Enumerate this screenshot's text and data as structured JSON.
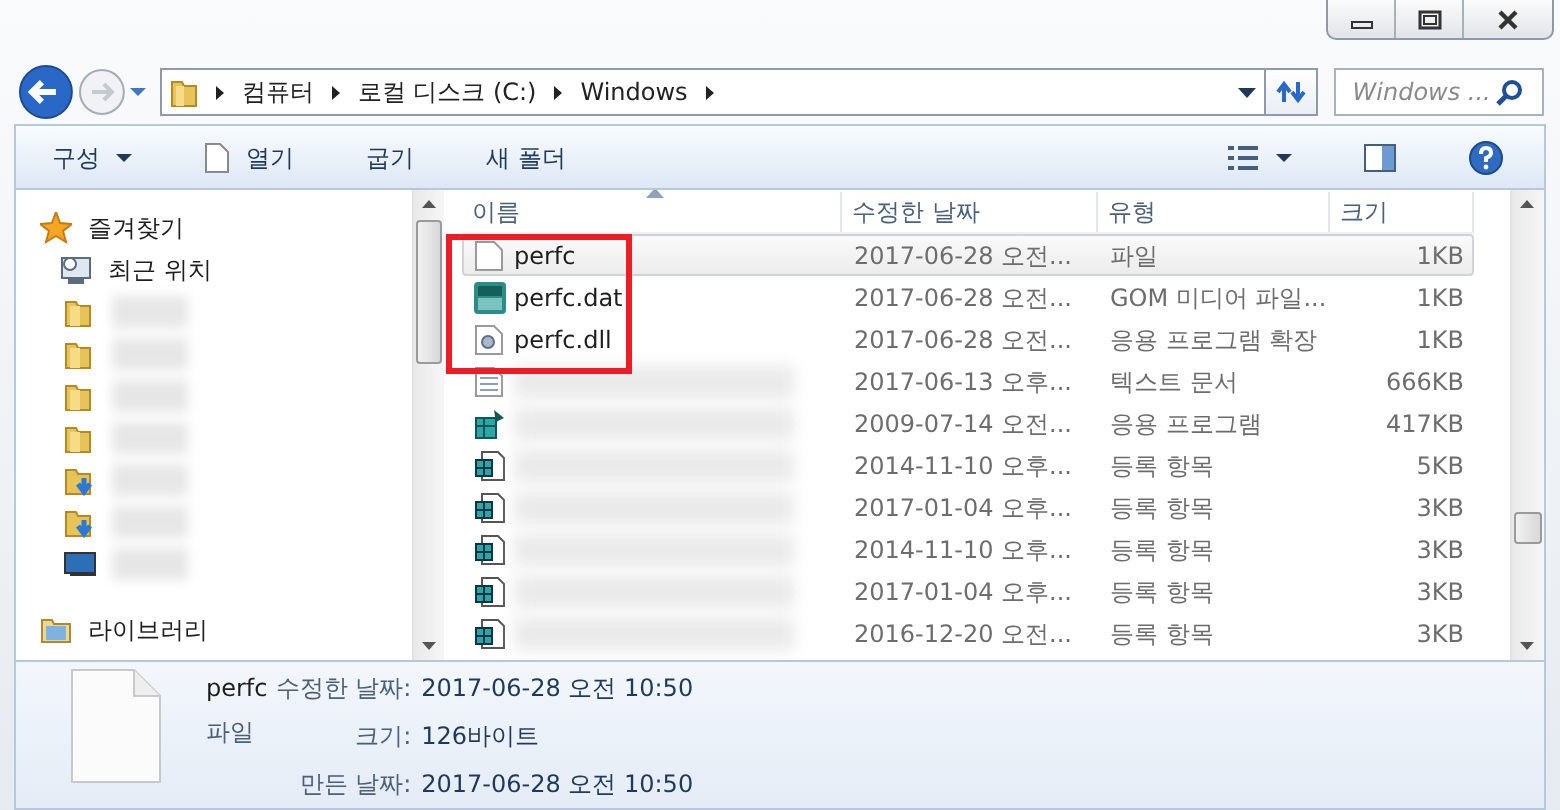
{
  "address": {
    "crumbs": [
      "컴퓨터",
      "로컬 디스크 (C:)",
      "Windows"
    ]
  },
  "search": {
    "placeholder": "Windows ..."
  },
  "toolbar": {
    "buttons": [
      {
        "label": "구성",
        "kind": "menu"
      },
      {
        "label": "열기",
        "kind": "open"
      },
      {
        "label": "굽기",
        "kind": "plain"
      },
      {
        "label": "새 폴더",
        "kind": "plain"
      }
    ]
  },
  "sidebar": {
    "items": [
      {
        "label": "즐겨찾기",
        "kind": "star"
      },
      {
        "label": "최근 위치",
        "kind": "recent"
      },
      {
        "kind": "folder"
      },
      {
        "kind": "folder"
      },
      {
        "kind": "folder"
      },
      {
        "kind": "folder"
      },
      {
        "kind": "download"
      },
      {
        "kind": "download"
      },
      {
        "kind": "desktop"
      },
      {
        "label": "라이브러리",
        "kind": "library"
      }
    ]
  },
  "table": {
    "columns": [
      "이름",
      "수정한 날짜",
      "유형",
      "크기"
    ],
    "rows": [
      {
        "name": "perfc",
        "date": "2017-06-28 오전...",
        "type": "파일",
        "size": "1KB",
        "kind": "blank",
        "selected": true,
        "highlighted": true
      },
      {
        "name": "perfc.dat",
        "date": "2017-06-28 오전...",
        "type": "GOM 미디어 파일...",
        "size": "1KB",
        "kind": "dat",
        "selected": false,
        "highlighted": true
      },
      {
        "name": "perfc.dll",
        "date": "2017-06-28 오전...",
        "type": "응용 프로그램 확장",
        "size": "1KB",
        "kind": "dll",
        "selected": false,
        "highlighted": true
      },
      {
        "date": "2017-06-13 오후...",
        "type": "텍스트 문서",
        "size": "666KB",
        "kind": "text",
        "selected": false
      },
      {
        "date": "2009-07-14 오전...",
        "type": "응용 프로그램",
        "size": "417KB",
        "kind": "app",
        "selected": false
      },
      {
        "date": "2014-11-10 오후...",
        "type": "등록 항목",
        "size": "5KB",
        "kind": "reg",
        "selected": false
      },
      {
        "date": "2017-01-04 오후...",
        "type": "등록 항목",
        "size": "3KB",
        "kind": "reg",
        "selected": false
      },
      {
        "date": "2014-11-10 오후...",
        "type": "등록 항목",
        "size": "3KB",
        "kind": "reg",
        "selected": false
      },
      {
        "date": "2017-01-04 오후...",
        "type": "등록 항목",
        "size": "3KB",
        "kind": "reg",
        "selected": false
      },
      {
        "date": "2016-12-20 오전...",
        "type": "등록 항목",
        "size": "3KB",
        "kind": "reg",
        "selected": false
      }
    ]
  },
  "details": {
    "name": "perfc",
    "type": "파일",
    "fields": [
      {
        "label": "수정한 날짜:",
        "value": "2017-06-28 오전 10:50"
      },
      {
        "label": "크기:",
        "value": "126바이트"
      },
      {
        "label": "만든 날짜:",
        "value": "2017-06-28 오전 10:50"
      }
    ]
  }
}
